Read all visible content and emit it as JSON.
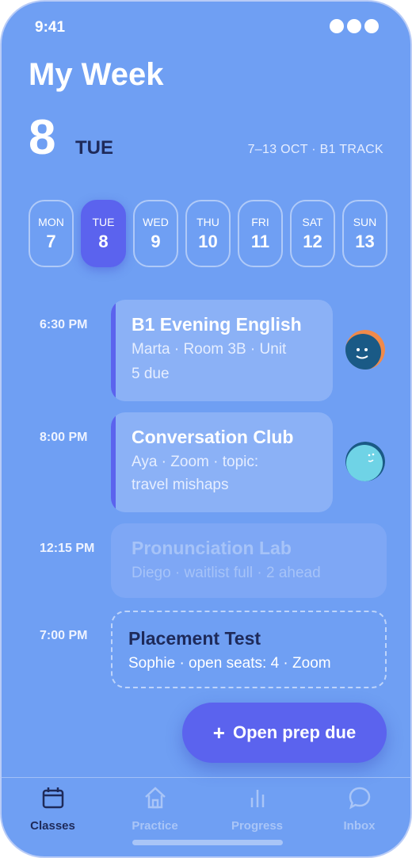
{
  "status": {
    "time": "9:41"
  },
  "header": {
    "title": "My Week",
    "date_number": "8",
    "day_name": "TUE",
    "range": "7–13 OCT · B1 TRACK"
  },
  "days": [
    {
      "name": "MON",
      "num": "7",
      "selected": false
    },
    {
      "name": "TUE",
      "num": "8",
      "selected": true
    },
    {
      "name": "WED",
      "num": "9",
      "selected": false
    },
    {
      "name": "THU",
      "num": "10",
      "selected": false
    },
    {
      "name": "FRI",
      "num": "11",
      "selected": false
    },
    {
      "name": "SAT",
      "num": "12",
      "selected": false
    },
    {
      "name": "SUN",
      "num": "13",
      "selected": false
    }
  ],
  "schedule": [
    {
      "time": "6:30 PM",
      "title": "B1 Evening English",
      "subtitle_line1": "Marta · Room 3B · Unit",
      "subtitle_line2": "5 due",
      "state": "active"
    },
    {
      "time": "8:00 PM",
      "title": "Conversation Club",
      "subtitle_line1": "Aya · Zoom · topic:",
      "subtitle_line2": "travel mishaps",
      "state": "active"
    },
    {
      "time": "12:15 PM",
      "title": "Pronunciation Lab",
      "subtitle_line1": "Diego · waitlist full · 2 ahead",
      "state": "disabled"
    },
    {
      "time": "7:00 PM",
      "title": "Placement Test",
      "subtitle_line1": "Sophie · open seats: 4 · Zoom",
      "state": "open"
    }
  ],
  "fab": {
    "plus": "+",
    "label": "Open prep due"
  },
  "nav": [
    {
      "label": "Classes",
      "icon": "calendar-icon",
      "active": true
    },
    {
      "label": "Practice",
      "icon": "home-icon",
      "active": false
    },
    {
      "label": "Progress",
      "icon": "bar-chart-icon",
      "active": false
    },
    {
      "label": "Inbox",
      "icon": "chat-bubble-icon",
      "active": false
    }
  ],
  "colors": {
    "background": "#6f9ff3",
    "accent": "#5b63ee",
    "dark_text": "#1e2a5a"
  }
}
